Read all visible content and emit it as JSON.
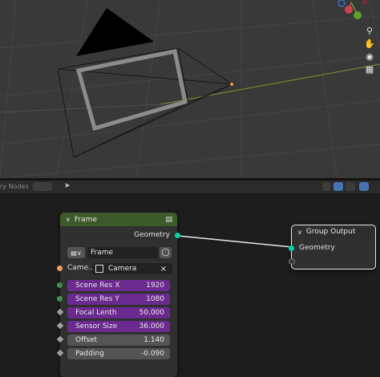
{
  "editor_header": {
    "title": "ry Nodes"
  },
  "frame_node": {
    "title": "Frame",
    "output_label": "Geometry",
    "object_selector_value": "Frame",
    "camera_label": "Came...",
    "camera_value": "Camera",
    "fields": [
      {
        "label": "Scene Res X",
        "value": "1920",
        "style": "purple"
      },
      {
        "label": "Scene Res Y",
        "value": "1080",
        "style": "purple"
      },
      {
        "label": "Focal Lenth",
        "value": "50.000",
        "style": "purple"
      },
      {
        "label": "Sensor Size",
        "value": "36.000",
        "style": "purple"
      },
      {
        "label": "Offset",
        "value": "1.140",
        "style": "gray"
      },
      {
        "label": "Padding",
        "value": "-0.090",
        "style": "gray"
      }
    ]
  },
  "group_output_node": {
    "title": "Group Output",
    "input_label": "Geometry"
  },
  "colors": {
    "frame_header": "#3d5a2b",
    "socket_geometry": "#00d6a3",
    "socket_object": "#ed9e5c",
    "socket_int": "#3f8f4f",
    "socket_float": "#a1a1a1",
    "purple_field": "#6b2a8f"
  }
}
